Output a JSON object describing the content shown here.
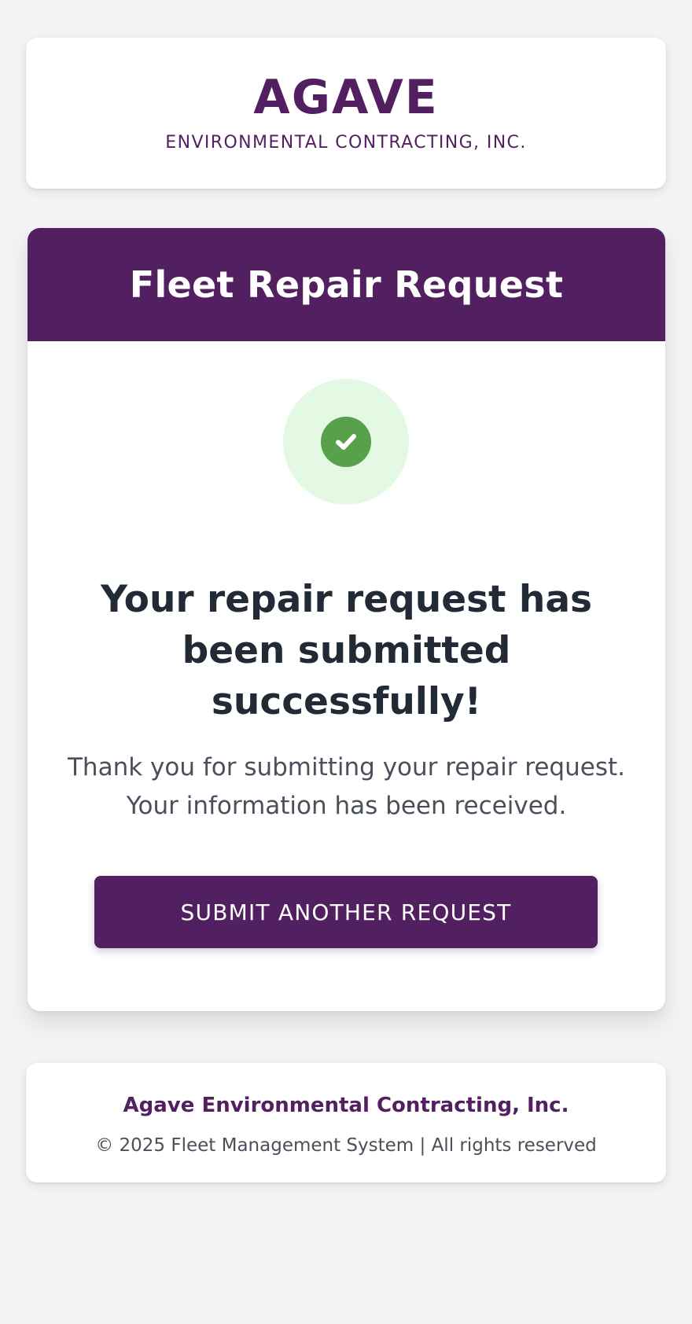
{
  "header": {
    "brand_name": "AGAVE",
    "brand_subtitle": "ENVIRONMENTAL CONTRACTING, INC."
  },
  "main": {
    "title": "Fleet Repair Request",
    "success_icon": "check-circle-icon",
    "headline": "Your repair request has been submitted successfully!",
    "message": "Thank you for submitting your repair request. Your information has been received.",
    "button_label": "SUBMIT ANOTHER REQUEST"
  },
  "footer": {
    "company": "Agave Environmental Contracting, Inc.",
    "copyright": "© 2025 Fleet Management System | All rights reserved"
  },
  "colors": {
    "brand": "#521f61",
    "success_green": "#57a14a",
    "success_bg": "#e3f9e3",
    "page_bg": "#f2f3f5"
  }
}
